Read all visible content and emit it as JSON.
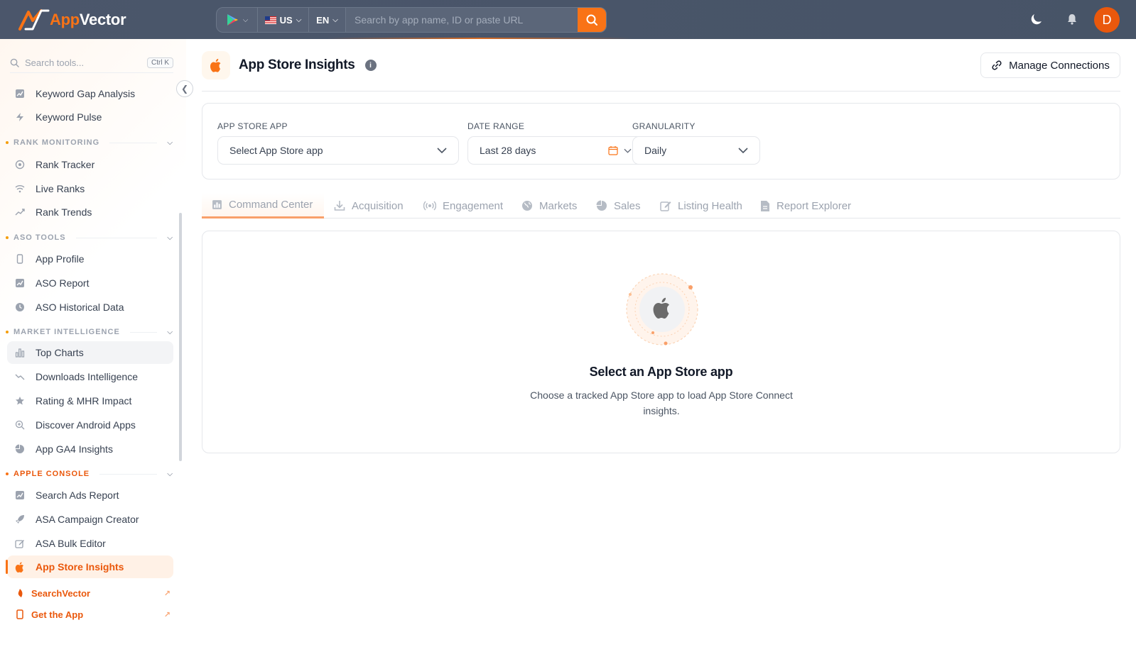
{
  "brand": {
    "part1": "App",
    "part2": "Vector"
  },
  "topbar": {
    "store_icon": "google-play-icon",
    "country": "US",
    "language": "EN",
    "search_placeholder": "Search by app name, ID or paste URL",
    "avatar_initial": "D"
  },
  "sidebar": {
    "search_placeholder": "Search tools...",
    "search_shortcut": "Ctrl K",
    "top_items": [
      {
        "label": "Keyword Gap Analysis",
        "icon": "chart-square-icon"
      },
      {
        "label": "Keyword Pulse",
        "icon": "bolt-icon"
      }
    ],
    "sections": [
      {
        "title": "RANK MONITORING",
        "items": [
          {
            "label": "Rank Tracker",
            "icon": "target-icon"
          },
          {
            "label": "Live Ranks",
            "icon": "wifi-icon"
          },
          {
            "label": "Rank Trends",
            "icon": "trend-up-icon"
          }
        ]
      },
      {
        "title": "ASO TOOLS",
        "items": [
          {
            "label": "App Profile",
            "icon": "phone-icon"
          },
          {
            "label": "ASO Report",
            "icon": "chart-square-icon"
          },
          {
            "label": "ASO Historical Data",
            "icon": "clock-icon"
          }
        ]
      },
      {
        "title": "MARKET INTELLIGENCE",
        "items": [
          {
            "label": "Top Charts",
            "icon": "bar-chart-icon"
          },
          {
            "label": "Downloads Intelligence",
            "icon": "trend-down-icon"
          },
          {
            "label": "Rating & MHR Impact",
            "icon": "star-icon"
          },
          {
            "label": "Discover Android Apps",
            "icon": "search-plus-icon"
          },
          {
            "label": "App GA4 Insights",
            "icon": "pie-icon"
          }
        ]
      },
      {
        "title": "APPLE CONSOLE",
        "items": [
          {
            "label": "Search Ads Report",
            "icon": "chart-square-icon"
          },
          {
            "label": "ASA Campaign Creator",
            "icon": "rocket-icon"
          },
          {
            "label": "ASA Bulk Editor",
            "icon": "edit-icon"
          },
          {
            "label": "App Store Insights",
            "icon": "apple-icon"
          }
        ]
      }
    ],
    "external": [
      {
        "label": "SearchVector",
        "icon": "searchvector-icon"
      },
      {
        "label": "Get the App",
        "icon": "phone-icon"
      }
    ]
  },
  "page": {
    "title": "App Store Insights",
    "manage_label": "Manage Connections"
  },
  "filters": {
    "app_label": "APP STORE APP",
    "app_value": "Select App Store app",
    "date_label": "DATE RANGE",
    "date_value": "Last 28 days",
    "gran_label": "GRANULARITY",
    "gran_value": "Daily"
  },
  "tabs": [
    {
      "label": "Command Center",
      "icon": "chart-square-icon",
      "active": true
    },
    {
      "label": "Acquisition",
      "icon": "download-icon"
    },
    {
      "label": "Engagement",
      "icon": "broadcast-icon"
    },
    {
      "label": "Markets",
      "icon": "globe-icon"
    },
    {
      "label": "Sales",
      "icon": "pie-icon"
    },
    {
      "label": "Listing Health",
      "icon": "edit-icon"
    },
    {
      "label": "Report Explorer",
      "icon": "file-icon"
    }
  ],
  "empty": {
    "title": "Select an App Store app",
    "subtitle": "Choose a tracked App Store app to load App Store Connect insights."
  },
  "colors": {
    "accent": "#f97316",
    "topbar": "#4b566b"
  }
}
